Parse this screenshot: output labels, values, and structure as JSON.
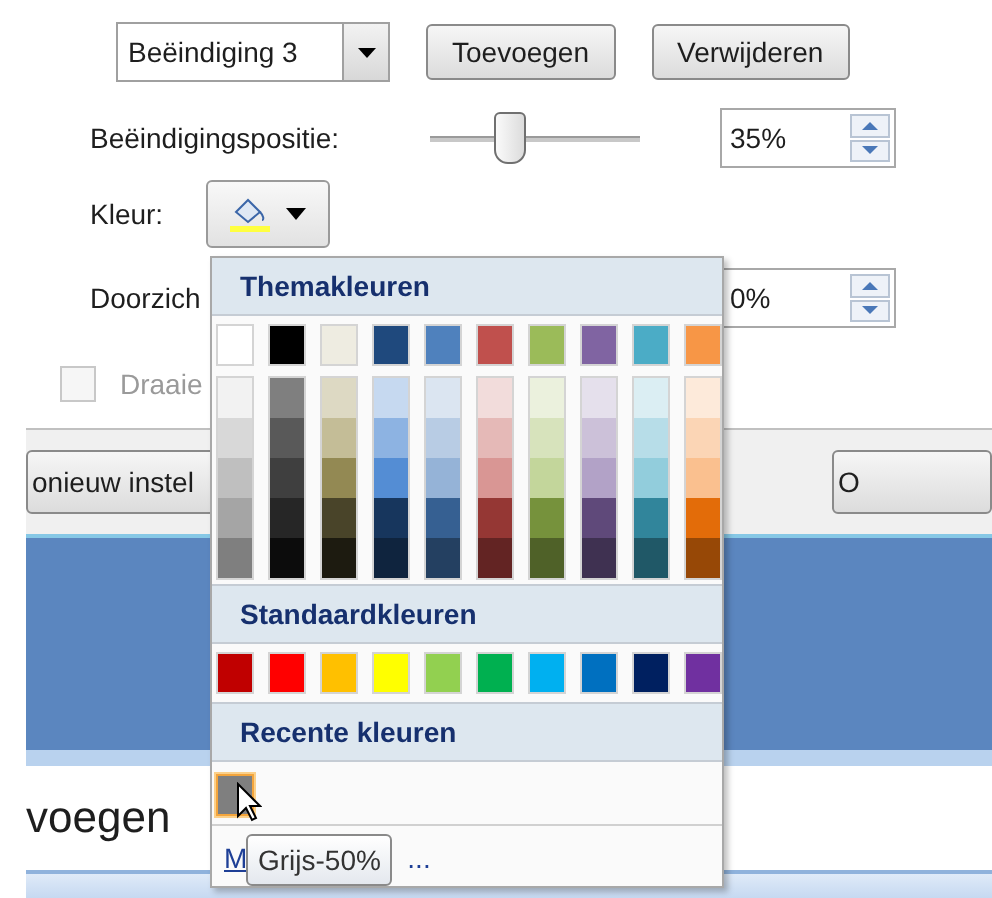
{
  "toolbar": {
    "combo": {
      "value": "Beëindiging 3"
    },
    "buttons": [
      "Toevoegen",
      "Verwijderen"
    ]
  },
  "position": {
    "label": "Beëindigingspositie:",
    "level": 0.37,
    "value": "35%"
  },
  "fill_color": {
    "label": "Kleur:"
  },
  "transparency": {
    "label": "Doorzich",
    "value": "0%"
  },
  "rotate": {
    "label": "Draaie",
    "checked": false,
    "disabled": true
  },
  "footer_buttons": [
    "onieuw instel",
    "O"
  ],
  "lower_text": "voegen",
  "color_menu": {
    "theme_title": "Themakleuren",
    "theme_colors": [
      {
        "color": "#ffffff",
        "shades": [
          {
            "color": "#f2f2f2"
          },
          {
            "color": "#d8d8d8"
          },
          {
            "color": "#bfbfbf"
          },
          {
            "color": "#a5a5a5"
          },
          {
            "color": "#7f7f7f"
          }
        ]
      },
      {
        "color": "#000000",
        "shades": [
          {
            "color": "#7f7f7f"
          },
          {
            "color": "#595959"
          },
          {
            "color": "#3f3f3f"
          },
          {
            "color": "#262626"
          },
          {
            "color": "#0c0c0c"
          }
        ]
      },
      {
        "color": "#eeece1",
        "shades": [
          {
            "color": "#ddd9c3"
          },
          {
            "color": "#c4bd97"
          },
          {
            "color": "#938953"
          },
          {
            "color": "#494429"
          },
          {
            "color": "#1d1b10"
          }
        ]
      },
      {
        "color": "#1f497d",
        "shades": [
          {
            "color": "#c6d9f0"
          },
          {
            "color": "#8db3e2"
          },
          {
            "color": "#548dd4"
          },
          {
            "color": "#17365d"
          },
          {
            "color": "#0f243e"
          }
        ]
      },
      {
        "color": "#4f81bd",
        "shades": [
          {
            "color": "#dbe5f1"
          },
          {
            "color": "#b8cce4"
          },
          {
            "color": "#95b3d7"
          },
          {
            "color": "#366092"
          },
          {
            "color": "#244061"
          }
        ]
      },
      {
        "color": "#c0504d",
        "shades": [
          {
            "color": "#f2dcdb"
          },
          {
            "color": "#e5b9b7"
          },
          {
            "color": "#d99694"
          },
          {
            "color": "#953734"
          },
          {
            "color": "#632423"
          }
        ]
      },
      {
        "color": "#9bbb59",
        "shades": [
          {
            "color": "#ebf1dd"
          },
          {
            "color": "#d7e3bc"
          },
          {
            "color": "#c3d69b"
          },
          {
            "color": "#76923c"
          },
          {
            "color": "#4f6128"
          }
        ]
      },
      {
        "color": "#8064a2",
        "shades": [
          {
            "color": "#e5e0ec"
          },
          {
            "color": "#ccc1d9"
          },
          {
            "color": "#b2a2c7"
          },
          {
            "color": "#5f497a"
          },
          {
            "color": "#3f3151"
          }
        ]
      },
      {
        "color": "#4bacc6",
        "shades": [
          {
            "color": "#dbeef3"
          },
          {
            "color": "#b7dde8"
          },
          {
            "color": "#92cddc"
          },
          {
            "color": "#31859b"
          },
          {
            "color": "#205867"
          }
        ]
      },
      {
        "color": "#f79646",
        "shades": [
          {
            "color": "#fdeada"
          },
          {
            "color": "#fbd5b5"
          },
          {
            "color": "#fac08f"
          },
          {
            "color": "#e36c09"
          },
          {
            "color": "#974806"
          }
        ]
      }
    ],
    "standard_title": "Standaardkleuren",
    "standard_colors": [
      {
        "color": "#c00000"
      },
      {
        "color": "#ff0000"
      },
      {
        "color": "#ffc000"
      },
      {
        "color": "#ffff00"
      },
      {
        "color": "#92d050"
      },
      {
        "color": "#00b050"
      },
      {
        "color": "#00b0f0"
      },
      {
        "color": "#0070c0"
      },
      {
        "color": "#002060"
      },
      {
        "color": "#7030a0"
      }
    ],
    "recent_title": "Recente kleuren",
    "recent_colors": [
      {
        "color": "#7f7f7f",
        "selected": true
      }
    ],
    "more_link": {
      "start": "M",
      "end": "..."
    }
  },
  "tooltip": "Grijs-50%"
}
